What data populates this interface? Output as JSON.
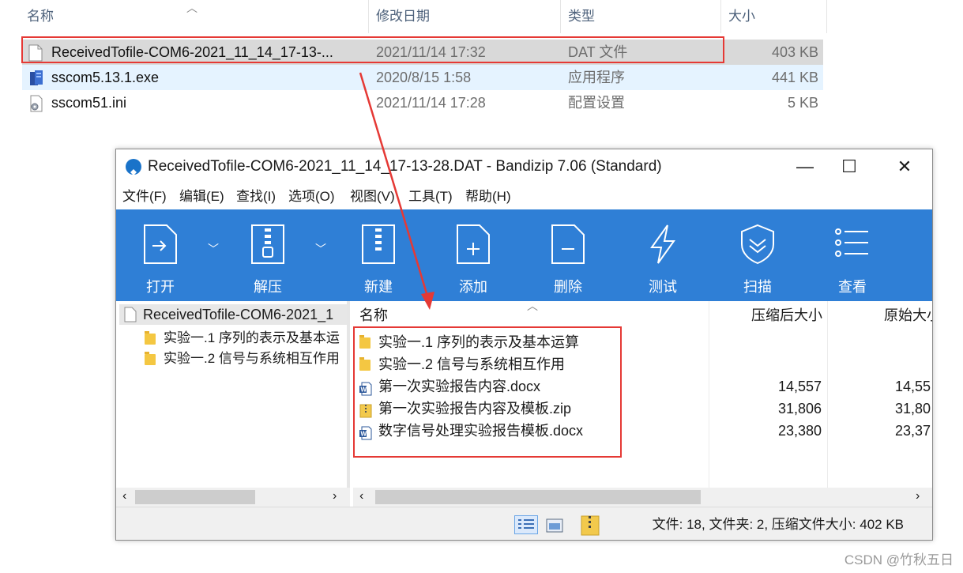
{
  "explorer": {
    "columns": {
      "name": "名称",
      "date": "修改日期",
      "type": "类型",
      "size": "大小"
    },
    "files": [
      {
        "name": "ReceivedTofile-COM6-2021_11_14_17-13-...",
        "date": "2021/11/14 17:32",
        "type": "DAT 文件",
        "size": "403 KB",
        "icon": "file-icon"
      },
      {
        "name": "sscom5.13.1.exe",
        "date": "2020/8/15 1:58",
        "type": "应用程序",
        "size": "441 KB",
        "icon": "exe-icon"
      },
      {
        "name": "sscom51.ini",
        "date": "2021/11/14 17:28",
        "type": "配置设置",
        "size": "5 KB",
        "icon": "ini-icon"
      }
    ]
  },
  "bandizip": {
    "title": "ReceivedTofile-COM6-2021_11_14_17-13-28.DAT - Bandizip 7.06 (Standard)",
    "window_controls": {
      "minimize": "—",
      "maximize": "☐",
      "close": "✕"
    },
    "menu": [
      "文件(F)",
      "编辑(E)",
      "查找(I)",
      "选项(O)",
      "视图(V)",
      "工具(T)",
      "帮助(H)"
    ],
    "toolbar": [
      "打开",
      "解压",
      "新建",
      "添加",
      "删除",
      "测试",
      "扫描",
      "查看"
    ],
    "tree": {
      "root": "ReceivedTofile-COM6-2021_1",
      "children": [
        "实验一.1 序列的表示及基本运",
        "实验一.2 信号与系统相互作用"
      ]
    },
    "list": {
      "columns": {
        "name": "名称",
        "compressed": "压缩后大小",
        "original": "原始大小"
      },
      "items": [
        {
          "name": "实验一.1 序列的表示及基本运算",
          "compressed": "",
          "original": "",
          "icon": "folder-icon"
        },
        {
          "name": "实验一.2 信号与系统相互作用",
          "compressed": "",
          "original": "",
          "icon": "folder-icon"
        },
        {
          "name": "第一次实验报告内容.docx",
          "compressed": "14,557",
          "original": "14,55",
          "icon": "word-icon"
        },
        {
          "name": "第一次实验报告内容及模板.zip",
          "compressed": "31,806",
          "original": "31,80",
          "icon": "zip-icon"
        },
        {
          "name": "数字信号处理实验报告模板.docx",
          "compressed": "23,380",
          "original": "23,37",
          "icon": "word-icon"
        }
      ]
    },
    "status": "文件: 18, 文件夹: 2, 压缩文件大小: 402 KB",
    "colors": {
      "toolbar": "#2f7fd6",
      "highlight": "#e53935"
    }
  },
  "watermark": "CSDN @竹秋五日"
}
